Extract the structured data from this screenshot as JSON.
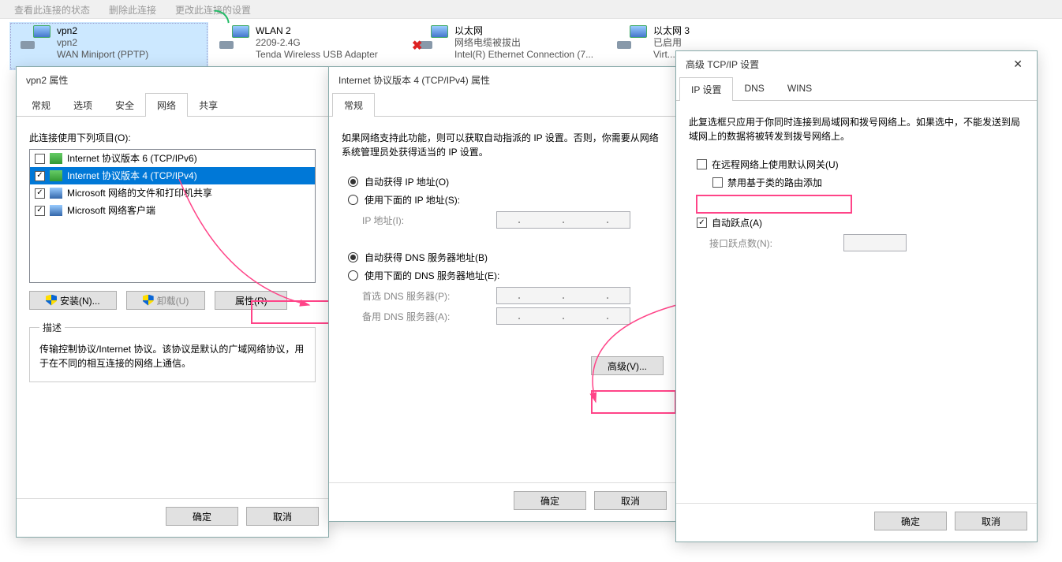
{
  "topbar": {
    "a": "查看此连接的状态",
    "b": "删除此连接",
    "c": "更改此连接的设置"
  },
  "adapters": [
    {
      "name": "vpn2",
      "l2": "vpn2",
      "l3": "WAN Miniport (PPTP)",
      "type": "vpn",
      "sel": true
    },
    {
      "name": "WLAN 2",
      "l2": "2209-2.4G",
      "l3": "Tenda Wireless USB Adapter",
      "type": "wifi"
    },
    {
      "name": "以太网",
      "l2": "网络电缆被拔出",
      "l3": "Intel(R) Ethernet Connection (7...",
      "type": "eth-x"
    },
    {
      "name": "以太网 3",
      "l2": "已启用",
      "l3": "Virt...",
      "type": "eth"
    }
  ],
  "dlg1": {
    "title": "vpn2 属性",
    "tabs": [
      "常规",
      "选项",
      "安全",
      "网络",
      "共享"
    ],
    "activeTab": 3,
    "listHeader": "此连接使用下列项目(O):",
    "items": [
      {
        "label": "Internet 协议版本 6 (TCP/IPv6)",
        "checked": false,
        "icon": "net",
        "sel": false
      },
      {
        "label": "Internet 协议版本 4 (TCP/IPv4)",
        "checked": true,
        "icon": "net",
        "sel": true
      },
      {
        "label": "Microsoft 网络的文件和打印机共享",
        "checked": true,
        "icon": "pc",
        "sel": false
      },
      {
        "label": "Microsoft 网络客户端",
        "checked": true,
        "icon": "pc",
        "sel": false
      }
    ],
    "install": "安装(N)...",
    "uninstall": "卸载(U)",
    "props": "属性(R)",
    "descTitle": "描述",
    "desc": "传输控制协议/Internet 协议。该协议是默认的广域网络协议，用于在不同的相互连接的网络上通信。",
    "ok": "确定",
    "cancel": "取消"
  },
  "dlg2": {
    "title": "Internet 协议版本 4 (TCP/IPv4) 属性",
    "tab": "常规",
    "intro": "如果网络支持此功能，则可以获取自动指派的 IP 设置。否则，你需要从网络系统管理员处获得适当的 IP 设置。",
    "r1": "自动获得 IP 地址(O)",
    "r2": "使用下面的 IP 地址(S):",
    "ipLabel": "IP 地址(I):",
    "r3": "自动获得 DNS 服务器地址(B)",
    "r4": "使用下面的 DNS 服务器地址(E):",
    "dns1": "首选 DNS 服务器(P):",
    "dns2": "备用 DNS 服务器(A):",
    "adv": "高级(V)...",
    "ok": "确定",
    "cancel": "取消"
  },
  "dlg3": {
    "title": "高级 TCP/IP 设置",
    "tabs": [
      "IP 设置",
      "DNS",
      "WINS"
    ],
    "intro": "此复选框只应用于你同时连接到局域网和拨号网络上。如果选中，不能发送到局域网上的数据将被转发到拨号网络上。",
    "c1": "在远程网络上使用默认网关(U)",
    "c2": "禁用基于类的路由添加",
    "c3": "自动跃点(A)",
    "metric": "接口跃点数(N):",
    "ok": "确定",
    "cancel": "取消"
  }
}
